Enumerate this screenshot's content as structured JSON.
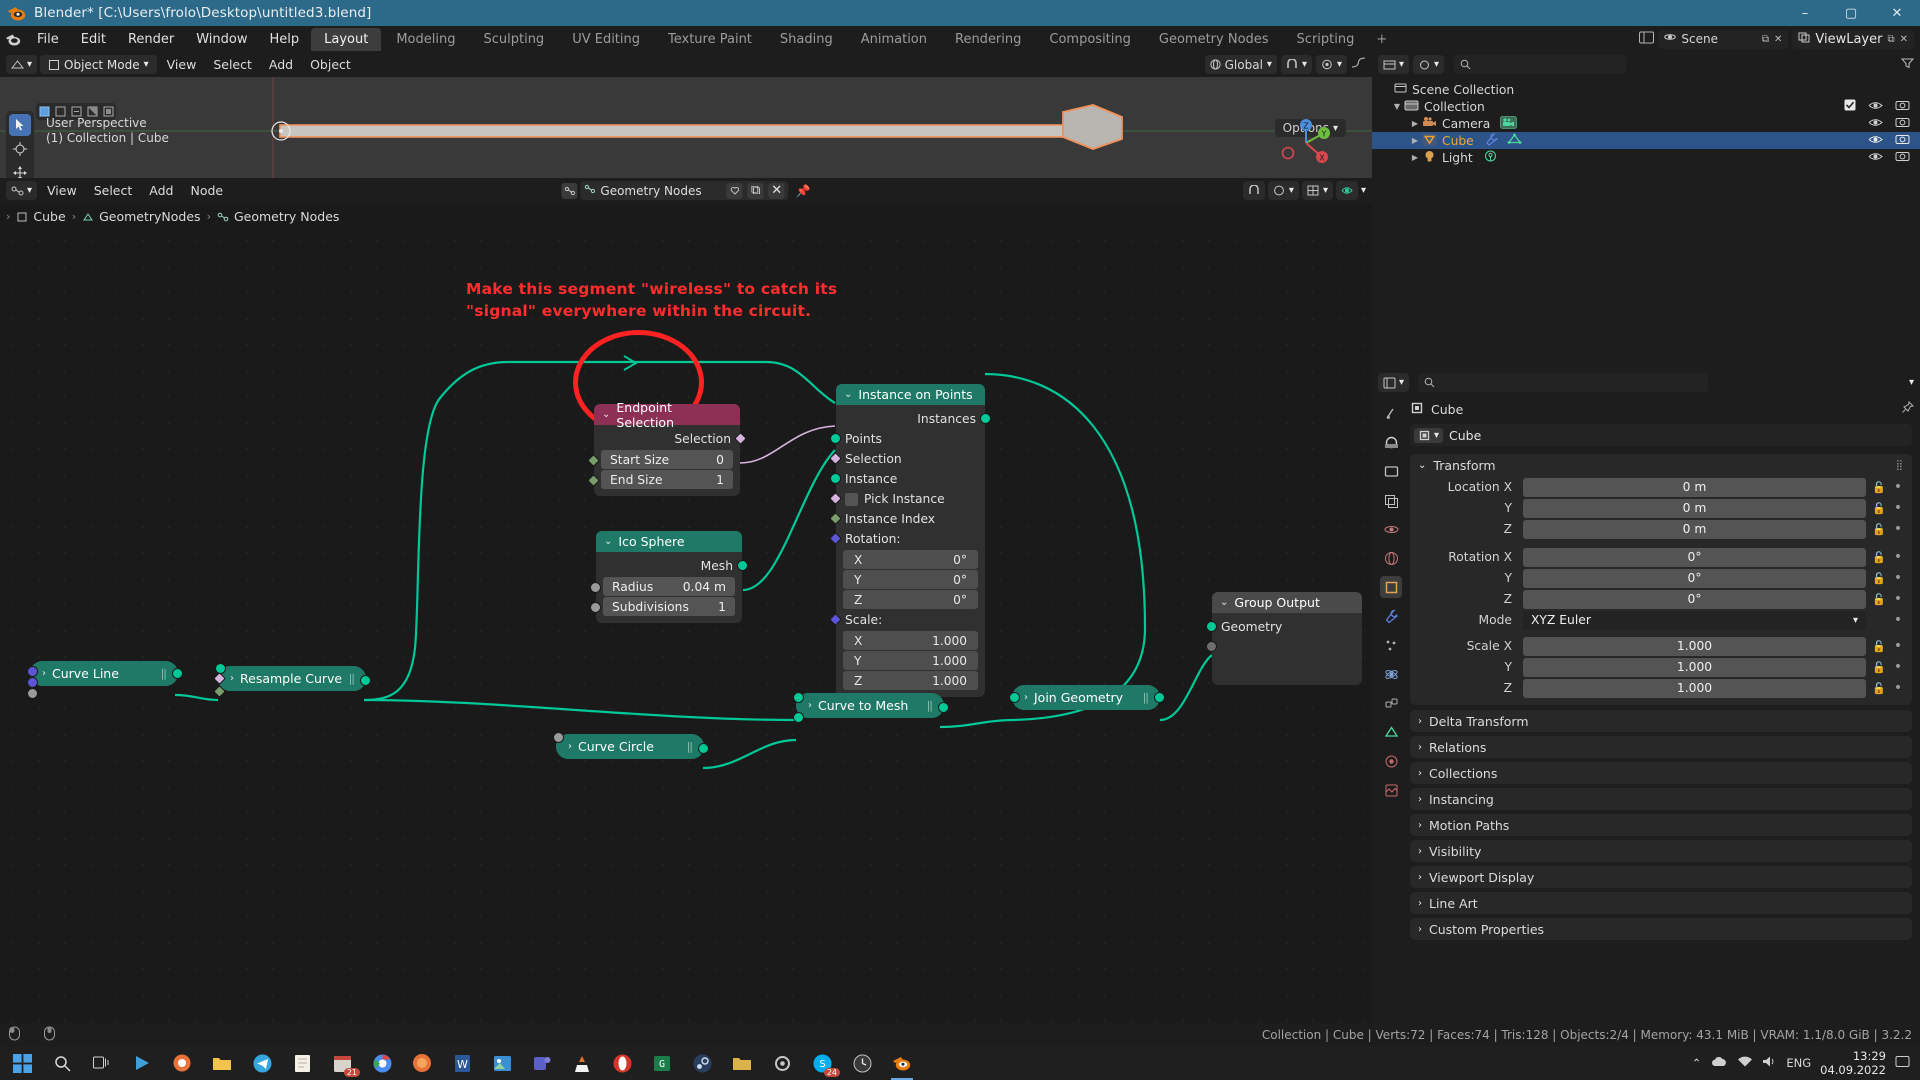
{
  "window": {
    "title": "Blender* [C:\\Users\\frolo\\Desktop\\untitled3.blend]",
    "minimize": "–",
    "maximize": "▢",
    "close": "✕"
  },
  "topmenu": {
    "items": [
      "File",
      "Edit",
      "Render",
      "Window",
      "Help"
    ],
    "workspaces": [
      {
        "label": "Layout",
        "active": true
      },
      {
        "label": "Modeling",
        "active": false
      },
      {
        "label": "Sculpting",
        "active": false
      },
      {
        "label": "UV Editing",
        "active": false
      },
      {
        "label": "Texture Paint",
        "active": false
      },
      {
        "label": "Shading",
        "active": false
      },
      {
        "label": "Animation",
        "active": false
      },
      {
        "label": "Rendering",
        "active": false
      },
      {
        "label": "Compositing",
        "active": false
      },
      {
        "label": "Geometry Nodes",
        "active": false
      },
      {
        "label": "Scripting",
        "active": false
      }
    ],
    "add_workspace": "+",
    "scene_name": "Scene",
    "viewlayer_name": "ViewLayer"
  },
  "viewport": {
    "mode": "Object Mode",
    "menus": [
      "View",
      "Select",
      "Add",
      "Object"
    ],
    "transform_orientation": "Global",
    "options_label": "Options",
    "overlay_line1": "User Perspective",
    "overlay_line2": "(1) Collection | Cube",
    "gizmo_axes": [
      "X",
      "Y",
      "Z"
    ]
  },
  "nodeeditor": {
    "menus": [
      "View",
      "Select",
      "Add",
      "Node"
    ],
    "tree_name": "Geometry Nodes",
    "breadcrumb": [
      "Cube",
      "GeometryNodes",
      "Geometry Nodes"
    ],
    "annotation": "Make this segment \"wireless\" to catch its\n\"signal\" everywhere within the circuit.",
    "nodes": {
      "instance_on_points": {
        "title": "Instance on Points",
        "output": "Instances",
        "inputs": [
          "Points",
          "Selection",
          "Instance"
        ],
        "pick_instance": "Pick Instance",
        "instance_index": "Instance Index",
        "rotation_label": "Rotation:",
        "rotation": [
          {
            "axis": "X",
            "value": "0°"
          },
          {
            "axis": "Y",
            "value": "0°"
          },
          {
            "axis": "Z",
            "value": "0°"
          }
        ],
        "scale_label": "Scale:",
        "scale": [
          {
            "axis": "X",
            "value": "1.000"
          },
          {
            "axis": "Y",
            "value": "1.000"
          },
          {
            "axis": "Z",
            "value": "1.000"
          }
        ]
      },
      "endpoint_selection": {
        "title": "Endpoint Selection",
        "output": "Selection",
        "fields": [
          {
            "label": "Start Size",
            "value": "0"
          },
          {
            "label": "End Size",
            "value": "1"
          }
        ]
      },
      "ico_sphere": {
        "title": "Ico Sphere",
        "output": "Mesh",
        "fields": [
          {
            "label": "Radius",
            "value": "0.04 m"
          },
          {
            "label": "Subdivisions",
            "value": "1"
          }
        ]
      },
      "group_output": {
        "title": "Group Output",
        "input": "Geometry"
      },
      "curve_line": {
        "title": "Curve Line"
      },
      "resample_curve": {
        "title": "Resample Curve"
      },
      "curve_to_mesh": {
        "title": "Curve to Mesh"
      },
      "curve_circle": {
        "title": "Curve Circle"
      },
      "join_geometry": {
        "title": "Join Geometry"
      }
    }
  },
  "outliner": {
    "search_placeholder": "",
    "root": "Scene Collection",
    "items": [
      {
        "name": "Collection",
        "indent": 1,
        "selected": false,
        "icon": "collection-icon"
      },
      {
        "name": "Camera",
        "indent": 2,
        "selected": false,
        "icon": "camera-icon"
      },
      {
        "name": "Cube",
        "indent": 2,
        "selected": true,
        "icon": "mesh-icon"
      },
      {
        "name": "Light",
        "indent": 2,
        "selected": false,
        "icon": "light-icon"
      }
    ]
  },
  "properties": {
    "breadcrumb_object": "Cube",
    "object_name": "Cube",
    "transform": {
      "title": "Transform",
      "rows": [
        {
          "label": "Location X",
          "value": "0 m"
        },
        {
          "label": "Y",
          "value": "0 m"
        },
        {
          "label": "Z",
          "value": "0 m"
        },
        {
          "label": "Rotation X",
          "value": "0°"
        },
        {
          "label": "Y",
          "value": "0°"
        },
        {
          "label": "Z",
          "value": "0°"
        }
      ],
      "mode_label": "Mode",
      "mode_value": "XYZ Euler",
      "scale_rows": [
        {
          "label": "Scale X",
          "value": "1.000"
        },
        {
          "label": "Y",
          "value": "1.000"
        },
        {
          "label": "Z",
          "value": "1.000"
        }
      ]
    },
    "panels": [
      "Delta Transform",
      "Relations",
      "Collections",
      "Instancing",
      "Motion Paths",
      "Visibility",
      "Viewport Display",
      "Line Art",
      "Custom Properties"
    ]
  },
  "statusbar": {
    "stats": "Collection | Cube | Verts:72 | Faces:74 | Tris:128 | Objects:2/4 | Memory: 43.1 MiB | VRAM: 1.1/8.0 GiB | 3.2.2"
  },
  "taskbar": {
    "lang": "ENG",
    "time": "13:29",
    "date": "04.09.2022",
    "badge_counts": [
      "21",
      "24"
    ]
  },
  "colors": {
    "accent_blue": "#2d6a8a",
    "node_green": "#1e7a66",
    "node_red": "#8c3055",
    "wire_green": "#00c896",
    "annotation_red": "#ff2d2d",
    "selected_blue": "#2c5488"
  }
}
